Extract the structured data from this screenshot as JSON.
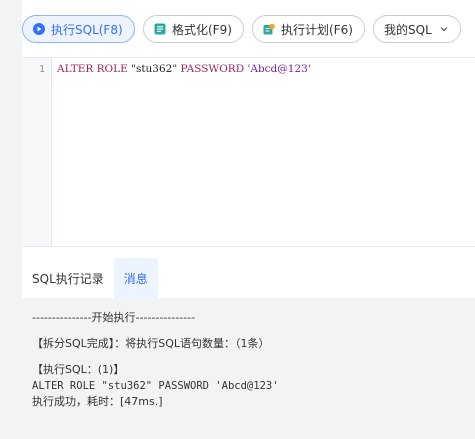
{
  "toolbar": {
    "run_label": "执行SQL(F8)",
    "format_label": "格式化(F9)",
    "plan_label": "执行计划(F6)",
    "mysql_label": "我的SQL"
  },
  "editor": {
    "line_number": "1",
    "tokens": {
      "kw1": "ALTER ROLE ",
      "name": "\"stu362\"",
      "kw2": " PASSWORD ",
      "pwd": "'Abcd@123'"
    }
  },
  "tabs": [
    {
      "label": "SQL执行记录",
      "active": false
    },
    {
      "label": "消息",
      "active": true
    }
  ],
  "console": {
    "start": "---------------开始执行---------------",
    "split": "【拆分SQL完成】：将执行SQL语句数量：（1条）",
    "exec_header": "【执行SQL：(1)】",
    "sql": "ALTER ROLE \"stu362\" PASSWORD 'Abcd@123'",
    "result": "执行成功，耗时：[47ms.]"
  },
  "colors": {
    "accent": "#3370ff",
    "keyword": "#a0225c",
    "string": "#7a1fa2"
  },
  "icons": [
    "play-icon",
    "format-icon",
    "plan-icon",
    "chevron-down-icon"
  ]
}
